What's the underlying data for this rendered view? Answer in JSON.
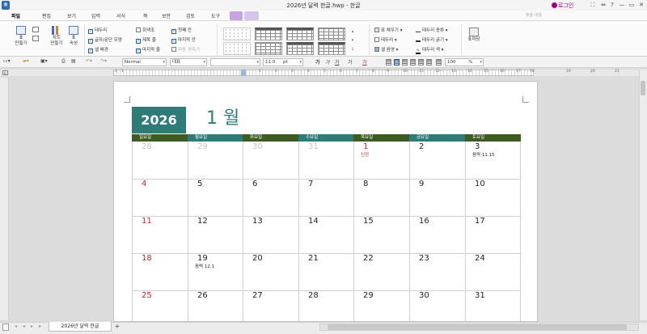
{
  "window": {
    "title": "2026년 달력 한글.hwp",
    "app_name": "한글",
    "login_label": "로그인",
    "controls": [
      "⛶",
      "⇔",
      "?",
      "—",
      "▭",
      "✕"
    ]
  },
  "menubar": {
    "items": [
      "파일",
      "편집",
      "보기",
      "입력",
      "서식",
      "쪽",
      "보안",
      "검토",
      "도구"
    ],
    "search_placeholder": "찾을 내용"
  },
  "ribbon": {
    "buttons": [
      {
        "label1": "표",
        "label2": "만들기"
      },
      {
        "label1": "차트",
        "label2": "만들기"
      },
      {
        "label1": "표",
        "label2": "속성"
      }
    ],
    "checks_col1": [
      {
        "label": "테두리",
        "checked": true
      },
      {
        "label": "글자/문단 모양",
        "checked": true
      },
      {
        "label": "셀 배경",
        "checked": true
      }
    ],
    "checks_col2": [
      {
        "label": "회색조",
        "checked": false
      },
      {
        "label": "제목 줄",
        "checked": true
      },
      {
        "label": "마지막 줄",
        "checked": true
      }
    ],
    "checks_col3": [
      {
        "label": "첫째 칸",
        "checked": true
      },
      {
        "label": "마지막 칸",
        "checked": true
      },
      {
        "label": "자동 꾸미기",
        "checked": false,
        "disabled": true
      }
    ],
    "right_col1": [
      "표 채우기",
      "테두리",
      "셀 음영"
    ],
    "right_col2": [
      "테두리 종류",
      "테두리 굵기",
      "테두리 색"
    ],
    "table_format_label": "표마당"
  },
  "format_toolbar": {
    "style": "Normal",
    "font_face": "대표",
    "font_name": "",
    "font_size": "11.0",
    "unit": "pt",
    "text_buttons": [
      "가",
      "가",
      "가",
      "가",
      "가"
    ],
    "zoom": "100",
    "zoom_unit": "%"
  },
  "ruler": {
    "numbers": [
      "2",
      "1",
      "1",
      "2",
      "3",
      "4",
      "5",
      "6",
      "7",
      "8",
      "9",
      "10",
      "11",
      "12",
      "13",
      "14",
      "15",
      "16",
      "17",
      "18",
      "19",
      "20",
      "21"
    ]
  },
  "calendar": {
    "year": "2026",
    "month": "1 월",
    "weekdays": [
      "일요일",
      "월요일",
      "화요일",
      "수요일",
      "목요일",
      "금요일",
      "토요일"
    ],
    "weeks": [
      [
        {
          "d": "28",
          "t": "grey"
        },
        {
          "d": "29",
          "t": "grey"
        },
        {
          "d": "30",
          "t": "grey"
        },
        {
          "d": "31",
          "t": "grey"
        },
        {
          "d": "1",
          "t": "red",
          "note": "신정"
        },
        {
          "d": "2",
          "t": ""
        },
        {
          "d": "3",
          "t": "",
          "note": "음력 11.15"
        }
      ],
      [
        {
          "d": "4",
          "t": "red"
        },
        {
          "d": "5",
          "t": ""
        },
        {
          "d": "6",
          "t": ""
        },
        {
          "d": "7",
          "t": ""
        },
        {
          "d": "8",
          "t": ""
        },
        {
          "d": "9",
          "t": ""
        },
        {
          "d": "10",
          "t": ""
        }
      ],
      [
        {
          "d": "11",
          "t": "red"
        },
        {
          "d": "12",
          "t": ""
        },
        {
          "d": "13",
          "t": ""
        },
        {
          "d": "14",
          "t": ""
        },
        {
          "d": "15",
          "t": ""
        },
        {
          "d": "16",
          "t": ""
        },
        {
          "d": "17",
          "t": ""
        }
      ],
      [
        {
          "d": "18",
          "t": "red"
        },
        {
          "d": "19",
          "t": "",
          "note": "음력 12.1"
        },
        {
          "d": "20",
          "t": ""
        },
        {
          "d": "21",
          "t": ""
        },
        {
          "d": "22",
          "t": ""
        },
        {
          "d": "23",
          "t": ""
        },
        {
          "d": "24",
          "t": ""
        }
      ],
      [
        {
          "d": "25",
          "t": "red"
        },
        {
          "d": "26",
          "t": ""
        },
        {
          "d": "27",
          "t": ""
        },
        {
          "d": "28",
          "t": ""
        },
        {
          "d": "29",
          "t": ""
        },
        {
          "d": "30",
          "t": ""
        },
        {
          "d": "31",
          "t": ""
        }
      ]
    ]
  },
  "tabs": {
    "sheet_name": "2026년 달력 한글",
    "add_label": "+",
    "nav": [
      "◂",
      "◂",
      "▸",
      "▸"
    ]
  },
  "colors": {
    "accent_teal": "#2d7c78",
    "header_olive": "#3e5b22",
    "holiday_red": "#c1272d",
    "brand_purple": "#a0007a"
  }
}
